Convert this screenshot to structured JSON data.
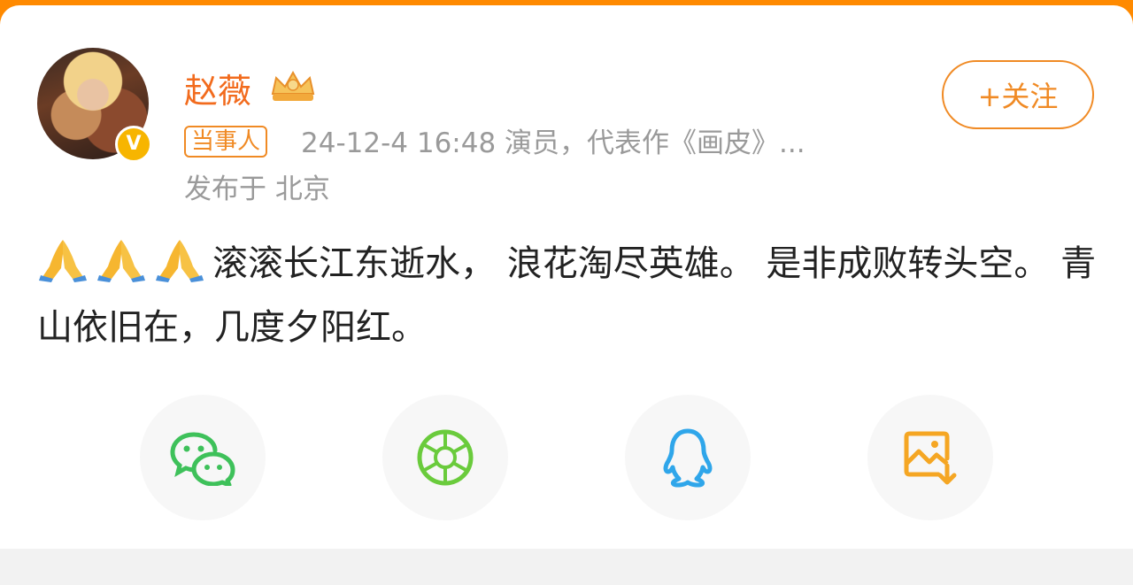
{
  "post": {
    "author": "赵薇",
    "tag": "当事人",
    "meta": "24-12-4 16:48  演员，代表作《画皮》...",
    "location": "发布于 北京",
    "verified_mark": "V",
    "body": "滚滚长江东逝水， 浪花淘尽英雄。 是非成败转头空。 青山依旧在，几度夕阳红。",
    "emojis": [
      "🙏",
      "🙏",
      "🙏"
    ]
  },
  "follow": {
    "label": "+关注"
  },
  "share": [
    {
      "name": "wechat",
      "icon": "wechat-icon",
      "color": "#3ec15a"
    },
    {
      "name": "moments",
      "icon": "moments-icon",
      "color": "#6acb3c"
    },
    {
      "name": "qq",
      "icon": "qq-icon",
      "color": "#2fa6ea"
    },
    {
      "name": "save-image",
      "icon": "save-image-icon",
      "color": "#f5a623"
    }
  ],
  "colors": {
    "accent": "#f08a24",
    "username": "#f26b1d",
    "top_bar": "#ff8a00"
  }
}
